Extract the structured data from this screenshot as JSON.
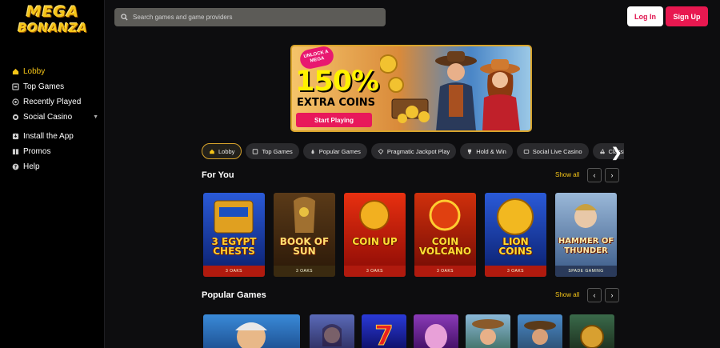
{
  "brand": {
    "line1": "MEGA",
    "line2": "BONANZA"
  },
  "sidebar": {
    "items": [
      {
        "label": "Lobby",
        "icon": "home-icon",
        "active": true
      },
      {
        "label": "Top Games",
        "icon": "trophy-icon"
      },
      {
        "label": "Recently Played",
        "icon": "history-icon"
      },
      {
        "label": "Social Casino",
        "icon": "chips-icon",
        "expandable": true
      },
      {
        "label": "Install the App",
        "icon": "download-icon"
      },
      {
        "label": "Promos",
        "icon": "gift-icon"
      },
      {
        "label": "Help",
        "icon": "help-icon"
      }
    ]
  },
  "header": {
    "search_placeholder": "Search games and game providers",
    "login_label": "Log In",
    "signup_label": "Sign Up"
  },
  "banner": {
    "tag": "UNLOCK A MEGA",
    "headline": "150%",
    "subline": "EXTRA COINS",
    "cta": "Start Playing"
  },
  "tabs": [
    {
      "label": "Lobby",
      "icon": "home-icon",
      "active": true
    },
    {
      "label": "Top Games",
      "icon": "trophy-icon"
    },
    {
      "label": "Popular Games",
      "icon": "flame-icon"
    },
    {
      "label": "Pragmatic Jackpot Play",
      "icon": "diamond-icon"
    },
    {
      "label": "Hold & Win",
      "icon": "trophy-cup-icon"
    },
    {
      "label": "Social Live Casino",
      "icon": "live-icon"
    },
    {
      "label": "Classic",
      "icon": "cherry-icon"
    }
  ],
  "for_you": {
    "title": "For You",
    "show_all": "Show all",
    "games": [
      {
        "title": "3 EGYPT CHESTS",
        "provider": "3 OAKS",
        "color": "#1a3a9a"
      },
      {
        "title": "BOOK OF SUN",
        "sub": "MULTICHANCE",
        "provider": "3 OAKS",
        "color": "#3a2410"
      },
      {
        "title": "COIN UP",
        "sub": "HOT FIRE",
        "provider": "3 OAKS",
        "color": "#c0180f"
      },
      {
        "title": "COIN VOLCANO",
        "provider": "3 OAKS",
        "color": "#b01a0e"
      },
      {
        "title": "LION COINS",
        "provider": "3 OAKS",
        "color": "#1a3a9a"
      },
      {
        "title": "HAMMER OF THUNDER",
        "provider": "SPADE GAMING",
        "color": "#5a7aa8"
      }
    ]
  },
  "popular": {
    "title": "Popular Games",
    "show_all": "Show all"
  },
  "colors": {
    "accent": "#f5c518",
    "signup": "#e81850",
    "login_text": "#e0114d"
  }
}
